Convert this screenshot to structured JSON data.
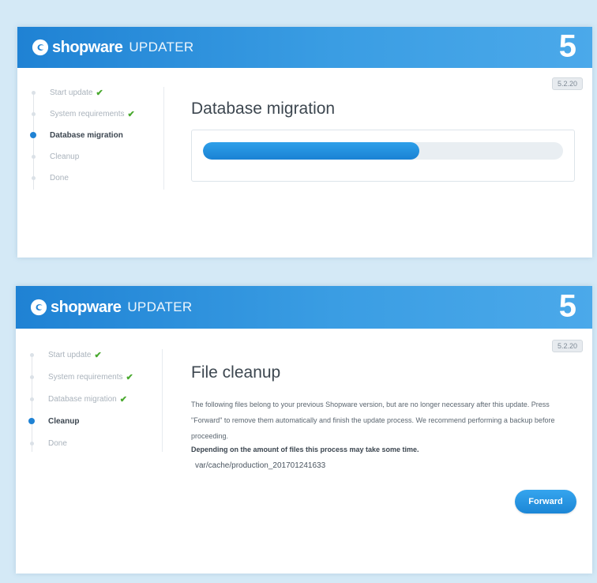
{
  "brand": {
    "name": "shopware",
    "product": "UPDATER",
    "major_version": "5",
    "color": "#1f82d4"
  },
  "screens": [
    {
      "version": "5.2.20",
      "steps": [
        {
          "label": "Start update",
          "done": true
        },
        {
          "label": "System requirements",
          "done": true
        },
        {
          "label": "Database migration",
          "active": true
        },
        {
          "label": "Cleanup"
        },
        {
          "label": "Done"
        }
      ],
      "title": "Database migration",
      "progress": 0.6
    },
    {
      "version": "5.2.20",
      "steps": [
        {
          "label": "Start update",
          "done": true
        },
        {
          "label": "System requirements",
          "done": true
        },
        {
          "label": "Database migration",
          "done": true
        },
        {
          "label": "Cleanup",
          "active": true
        },
        {
          "label": "Done"
        }
      ],
      "title": "File cleanup",
      "description": "The following files belong to your previous Shopware version, but are no longer necessary after this update. Press \"Forward\" to remove them automatically and finish the update process. We recommend performing a backup before proceeding.",
      "notice": "Depending on the amount of files this process may take some time.",
      "files": [
        "var/cache/production_201701241633"
      ],
      "forward_label": "Forward"
    }
  ],
  "check_glyph": "✔"
}
